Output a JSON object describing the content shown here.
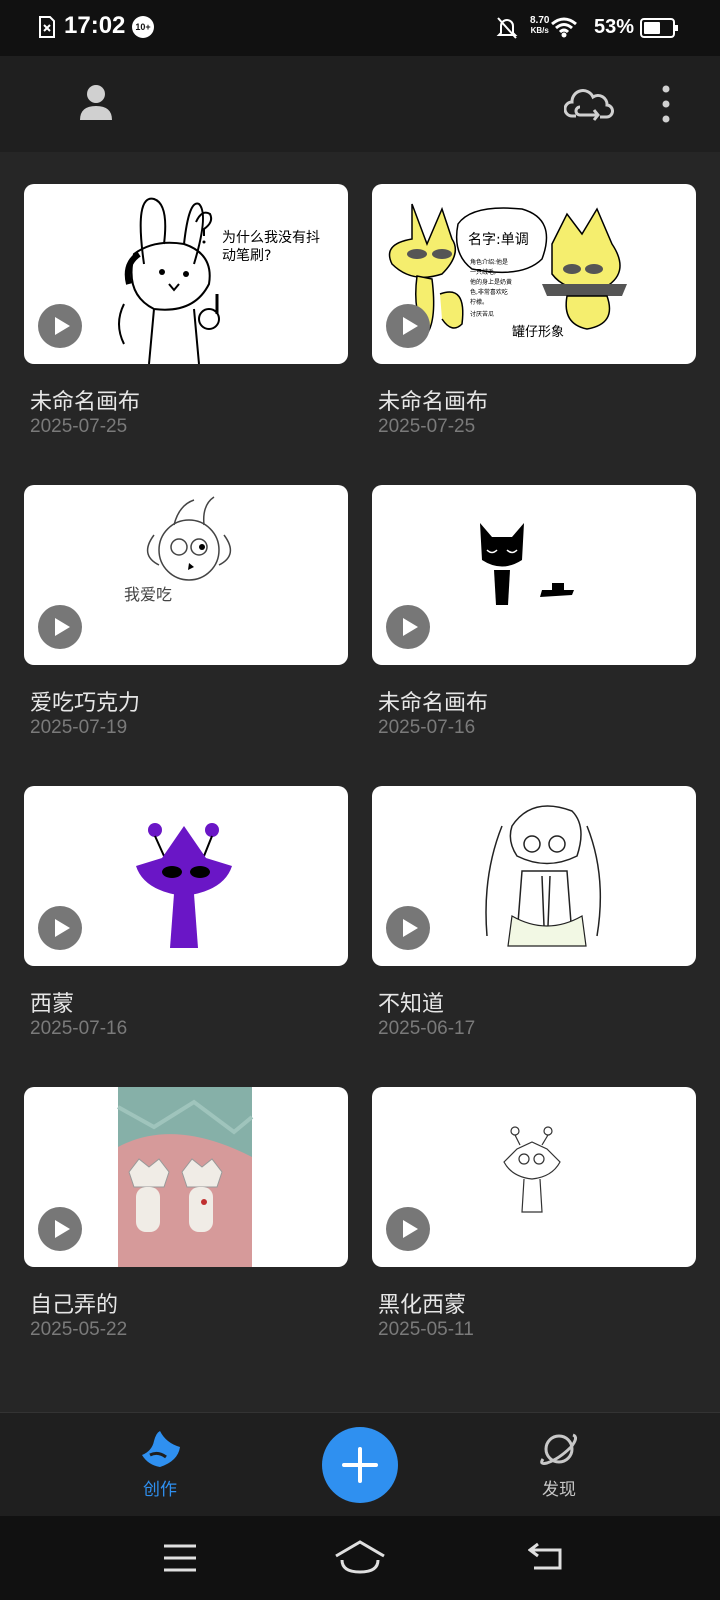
{
  "status_bar": {
    "time": "17:02",
    "notification_count": "10+",
    "net_speed_value": "8.70",
    "net_speed_unit": "KB/s",
    "battery_percent": "53%"
  },
  "top_bar": {
    "profile_icon": "user-icon",
    "cloud_icon": "cloud-sync-icon",
    "menu_icon": "more-vertical-icon"
  },
  "canvases": [
    {
      "title": "未命名画布",
      "date": "2025-07-25",
      "thumb": "sketch-character-with-question"
    },
    {
      "title": "未命名画布",
      "date": "2025-07-25",
      "thumb": "yellow-characters-profile"
    },
    {
      "title": "爱吃巧克力",
      "date": "2025-07-19",
      "thumb": "horned-character-sketch"
    },
    {
      "title": "未命名画布",
      "date": "2025-07-16",
      "thumb": "black-cat-and-hat"
    },
    {
      "title": "西蒙",
      "date": "2025-07-16",
      "thumb": "purple-character"
    },
    {
      "title": "不知道",
      "date": "2025-06-17",
      "thumb": "twin-tail-girl-sketch"
    },
    {
      "title": "自己弄的",
      "date": "2025-05-22",
      "thumb": "clay-figures-photo"
    },
    {
      "title": "黑化西蒙",
      "date": "2025-05-11",
      "thumb": "small-character-sketch"
    }
  ],
  "bottom_nav": {
    "create_label": "创作",
    "discover_label": "发现",
    "active_color": "#2f90f0",
    "add_icon": "plus-icon"
  },
  "thumb_text": {
    "speech_bubble": "为什么我没有抖动笔刷?",
    "name_tag": "名字:单调",
    "caption_group": "罐仔形象",
    "intro_line1": "角色介绍:他是",
    "intro_line2": "一只绒毛,",
    "intro_line3": "他的身上是奶黄",
    "intro_line4": "色,非常喜欢吃",
    "intro_line5": "柠檬。",
    "intro_line6": "讨厌苦瓜",
    "sketch_caption": "我爱吃"
  }
}
